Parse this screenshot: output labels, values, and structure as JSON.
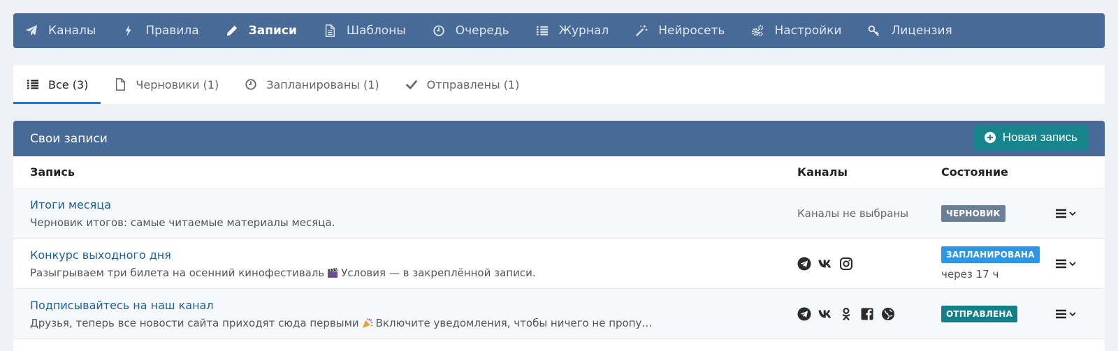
{
  "nav": {
    "items": [
      {
        "label": "Каналы",
        "icon": "paper-plane-icon"
      },
      {
        "label": "Правила",
        "icon": "lightning-icon"
      },
      {
        "label": "Записи",
        "icon": "pencil-icon",
        "active": true
      },
      {
        "label": "Шаблоны",
        "icon": "file-icon"
      },
      {
        "label": "Очередь",
        "icon": "clock-icon"
      },
      {
        "label": "Журнал",
        "icon": "list-icon"
      },
      {
        "label": "Нейросеть",
        "icon": "magic-wand-icon"
      },
      {
        "label": "Настройки",
        "icon": "gears-icon"
      },
      {
        "label": "Лицензия",
        "icon": "key-icon"
      }
    ]
  },
  "tabs": [
    {
      "label": "Все (3)",
      "icon": "list-icon",
      "active": true
    },
    {
      "label": "Черновики (1)",
      "icon": "file-icon"
    },
    {
      "label": "Запланированы (1)",
      "icon": "clock-icon"
    },
    {
      "label": "Отправлены (1)",
      "icon": "check-icon"
    }
  ],
  "panel": {
    "title": "Свои записи",
    "new_button": "Новая запись",
    "columns": {
      "record": "Запись",
      "channels": "Каналы",
      "status": "Состояние"
    }
  },
  "rows": [
    {
      "title": "Итоги месяца",
      "desc_before": "Черновик итогов: самые читаемые материалы месяца.",
      "desc_after": "",
      "emoji": "",
      "channels_text": "Каналы не выбраны",
      "channels": [],
      "status": "ЧЕРНОВИК",
      "status_sub": ""
    },
    {
      "title": "Конкурс выходного дня",
      "desc_before": "Разыгрываем три билета на осенний кинофестиваль",
      "desc_after": "Условия — в закреплённой записи.",
      "emoji": "clapperboard-emoji",
      "channels_text": "",
      "channels": [
        "telegram-icon",
        "vk-icon",
        "instagram-icon"
      ],
      "status": "ЗАПЛАНИРОВАНА",
      "status_sub": "через 17 ч"
    },
    {
      "title": "Подписывайтесь на наш канал",
      "desc_before": "Друзья, теперь все новости сайта приходят сюда первыми",
      "desc_after": "Включите уведомления, чтобы ничего не пропу…",
      "emoji": "party-popper-emoji",
      "channels_text": "",
      "channels": [
        "telegram-icon",
        "vk-icon",
        "odnoklassniki-icon",
        "facebook-icon",
        "globe-icon"
      ],
      "status": "ОТПРАВЛЕНА",
      "status_sub": ""
    }
  ],
  "colors": {
    "nav_bg": "#476a96",
    "accent_btn": "#16858c",
    "link": "#1f5e99",
    "draft": "#6c8095",
    "scheduled": "#2c97e6",
    "sent": "#138087"
  }
}
